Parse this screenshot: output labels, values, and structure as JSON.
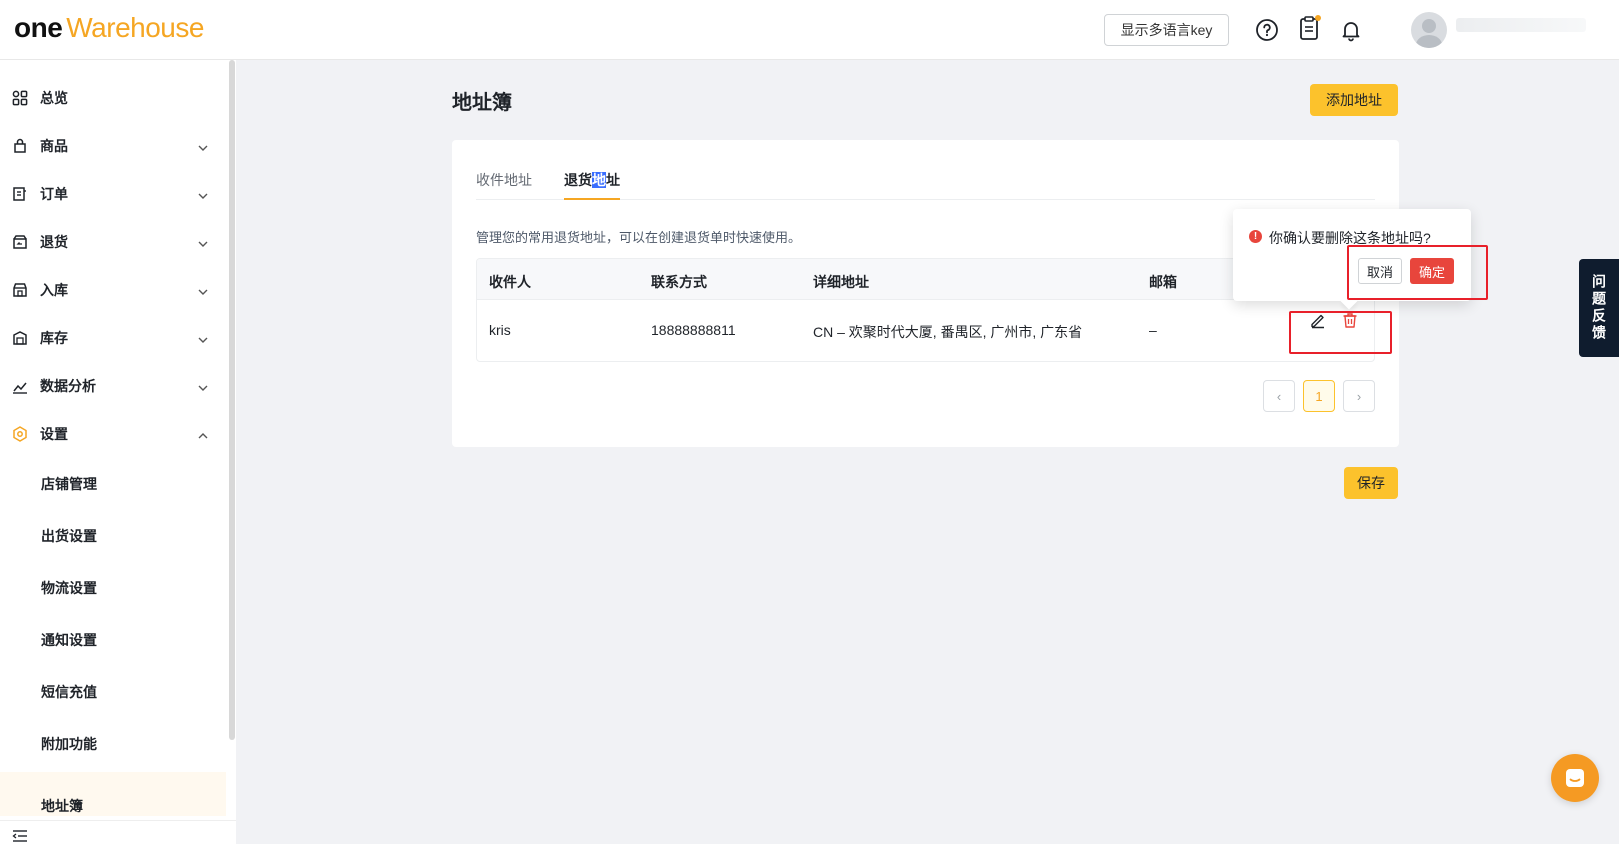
{
  "header": {
    "logo_one": "one",
    "logo_warehouse": "Warehouse",
    "lang_button": "显示多语言key"
  },
  "sidebar": {
    "items": [
      {
        "label": "总览",
        "icon": "grid-icon",
        "expandable": false
      },
      {
        "label": "商品",
        "icon": "bag-icon",
        "expandable": true
      },
      {
        "label": "订单",
        "icon": "order-icon",
        "expandable": true
      },
      {
        "label": "退货",
        "icon": "return-icon",
        "expandable": true
      },
      {
        "label": "入库",
        "icon": "inbound-icon",
        "expandable": true
      },
      {
        "label": "库存",
        "icon": "inventory-icon",
        "expandable": true
      },
      {
        "label": "数据分析",
        "icon": "chart-icon",
        "expandable": true
      },
      {
        "label": "设置",
        "icon": "settings-icon",
        "expandable": true,
        "expanded": true
      }
    ],
    "sub_items": [
      "店铺管理",
      "出货设置",
      "物流设置",
      "通知设置",
      "短信充值",
      "附加功能",
      "地址簿"
    ],
    "active_sub": "地址簿"
  },
  "page": {
    "title": "地址簿",
    "add_button": "添加地址",
    "save_button": "保存",
    "tabs": [
      {
        "label": "收件地址",
        "active": false
      },
      {
        "label_pre": "退货",
        "label_hl": "地",
        "label_post": "址",
        "active": true
      }
    ],
    "description": "管理您的常用退货地址，可以在创建退货单时快速使用。",
    "table": {
      "headers": [
        "收件人",
        "联系方式",
        "详细地址",
        "邮箱"
      ],
      "rows": [
        {
          "name": "kris",
          "phone": "18888888811",
          "address": "CN – 欢聚时代大厦, 番禺区, 广州市, 广东省",
          "email": "–"
        }
      ]
    },
    "pagination": {
      "current": "1",
      "prev": "‹",
      "next": "›"
    }
  },
  "popconfirm": {
    "message": "你确认要删除这条地址吗?",
    "cancel": "取消",
    "confirm": "确定"
  },
  "feedback_tab": "问题反馈",
  "colors": {
    "accent": "#fcc22c",
    "brand_orange": "#f5a623",
    "danger": "#e8453c",
    "highlight_box": "#e8202a"
  }
}
